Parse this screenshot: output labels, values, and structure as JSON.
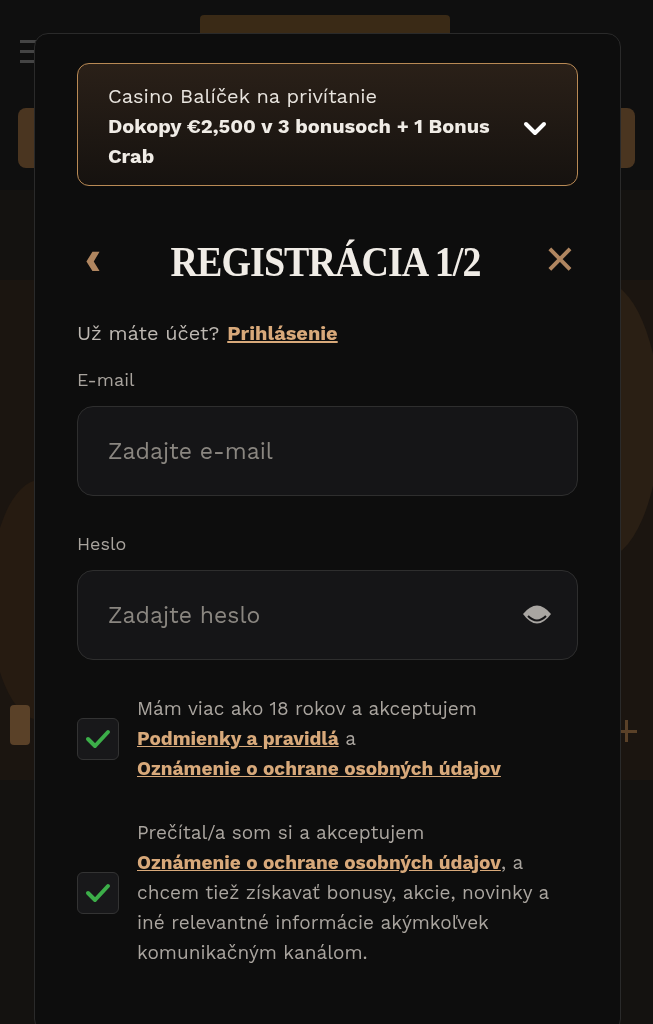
{
  "promo": {
    "title": "Casino Balíček na privítanie",
    "offer": "Dokopy €2,500 v 3 bonusoch + 1 Bonus Crab",
    "expanded": false
  },
  "dialog": {
    "back": "‹",
    "title": "REGISTRÁCIA 1/2",
    "close": "×"
  },
  "login_prompt": {
    "text": "Už máte účet?",
    "link": "Prihlásenie"
  },
  "fields": [
    {
      "label": "E-mail",
      "placeholder": "Zadajte e-mail",
      "kind": "email"
    },
    {
      "label": "Heslo",
      "placeholder": "Zadajte heslo",
      "kind": "password"
    }
  ],
  "consents": [
    {
      "checked": true,
      "parts": [
        {
          "kind": "text",
          "text": "Mám viac ako 18 rokov a akceptujem"
        },
        {
          "kind": "link",
          "text": "Podmienky a pravidlá"
        },
        {
          "kind": "text",
          "text": "a"
        },
        {
          "kind": "link",
          "text": "Oznámenie o ochrane osobných údajov"
        }
      ]
    },
    {
      "checked": true,
      "parts": [
        {
          "kind": "text",
          "text": "Prečítal/a som si a akceptujem"
        },
        {
          "kind": "link",
          "text": "Oznámenie o ochrane osobných údajov"
        },
        {
          "kind": "text",
          "text": ", a chcem tiež získavať bonusy, akcie, novinky a iné relevantné informácie akýmkoľvek komunikačným kanálom."
        }
      ]
    }
  ]
}
